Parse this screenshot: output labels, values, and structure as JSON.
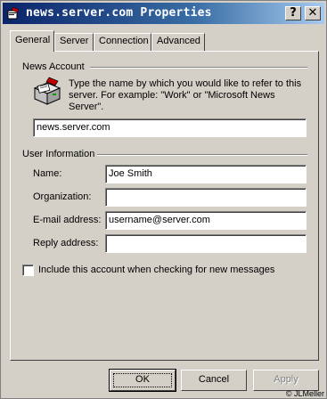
{
  "window": {
    "title": "news.server.com Properties",
    "help_glyph": "?",
    "close_glyph": "✕"
  },
  "tabs": [
    {
      "label": "General",
      "active": true
    },
    {
      "label": "Server",
      "active": false
    },
    {
      "label": "Connection",
      "active": false
    },
    {
      "label": "Advanced",
      "active": false
    }
  ],
  "news_account": {
    "heading": "News Account",
    "description": "Type the name by which you would like to refer to this server.  For example: \"Work\" or \"Microsoft News Server\".",
    "account_name": "news.server.com",
    "icon": "news-server-icon"
  },
  "user_info": {
    "heading": "User Information",
    "name": {
      "label": "Name:",
      "value": "Joe Smith"
    },
    "organization": {
      "label": "Organization:",
      "value": ""
    },
    "email": {
      "label": "E-mail address:",
      "value": "username@server.com"
    },
    "reply": {
      "label": "Reply address:",
      "value": ""
    }
  },
  "include_checkbox": {
    "label": "Include this account when checking for new messages",
    "checked": false
  },
  "buttons": {
    "ok": "OK",
    "cancel": "Cancel",
    "apply": "Apply"
  },
  "credit": "© JLMeller",
  "colors": {
    "face": "#d4d0c8",
    "title_start": "#0a246a",
    "title_end": "#a6caf0"
  }
}
